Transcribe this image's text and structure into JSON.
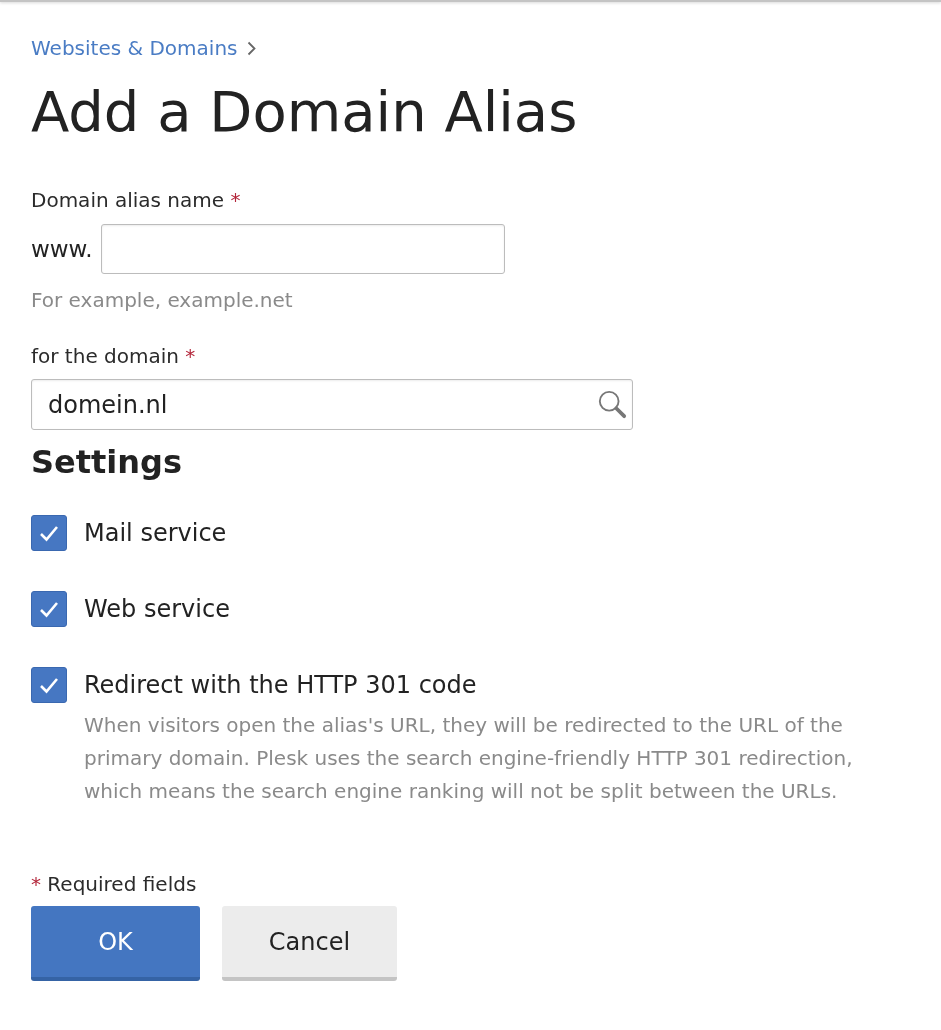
{
  "breadcrumb": {
    "items": [
      {
        "label": "Websites & Domains"
      }
    ]
  },
  "title": "Add a Domain Alias",
  "alias_name": {
    "label": "Domain alias name",
    "required_mark": "*",
    "prefix": "www.",
    "hint": "For example, example.net"
  },
  "domain": {
    "label": "for the domain",
    "required_mark": "*",
    "value": "domein.nl"
  },
  "settings": {
    "heading": "Settings",
    "options": [
      {
        "label": "Mail service",
        "checked": true
      },
      {
        "label": "Web service",
        "checked": true
      },
      {
        "label": "Redirect with the HTTP 301 code",
        "checked": true,
        "description": "When visitors open the alias's URL, they will be redirected to the URL of the primary domain. Plesk uses the search engine-friendly HTTP 301 redirection, which means the search engine ranking will not be split between the URLs."
      }
    ]
  },
  "required_note": {
    "mark": "*",
    "text": "Required fields"
  },
  "buttons": [
    {
      "label": "OK",
      "kind": "primary"
    },
    {
      "label": "Cancel",
      "kind": "secondary"
    }
  ]
}
